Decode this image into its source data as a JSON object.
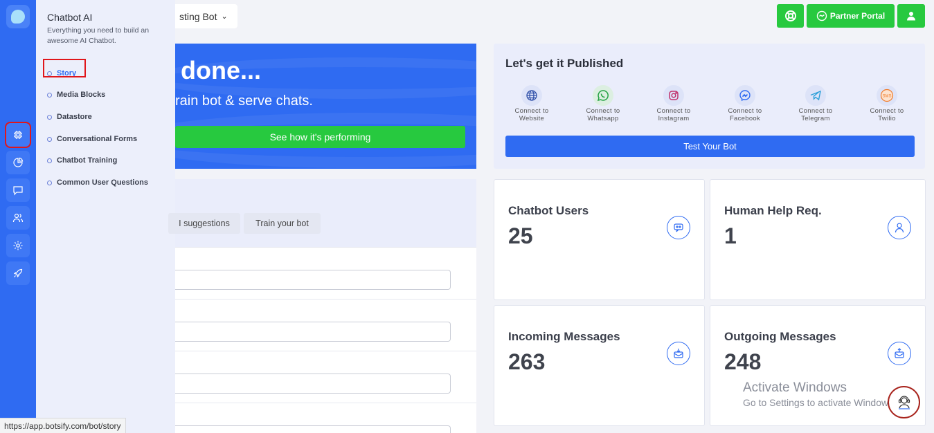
{
  "sidebar": {
    "icons": [
      "chatbot-icon",
      "pie-chart-icon",
      "message-icon",
      "users-icon",
      "gear-icon",
      "rocket-icon"
    ]
  },
  "flyout": {
    "title": "Chatbot AI",
    "description": "Everything you need to build an awesome AI Chatbot.",
    "items": [
      {
        "label": "Story"
      },
      {
        "label": "Media Blocks"
      },
      {
        "label": "Datastore"
      },
      {
        "label": "Conversational Forms"
      },
      {
        "label": "Chatbot Training"
      },
      {
        "label": "Common User Questions"
      }
    ]
  },
  "header": {
    "bot_name": "sting Bot",
    "partner_portal": "Partner Portal"
  },
  "hero": {
    "title": " done...",
    "subtitle": "rain bot & serve chats.",
    "cta": "See how it's performing"
  },
  "publish": {
    "title": "Let's get it Published",
    "channels": [
      {
        "line1": "Connect to",
        "line2": "Website",
        "icon": "globe-icon"
      },
      {
        "line1": "Connect to",
        "line2": "Whatsapp",
        "icon": "whatsapp-icon"
      },
      {
        "line1": "Connect to",
        "line2": "Instagram",
        "icon": "instagram-icon"
      },
      {
        "line1": "Connect to",
        "line2": "Facebook",
        "icon": "messenger-icon"
      },
      {
        "line1": "Connect to",
        "line2": "Telegram",
        "icon": "telegram-icon"
      },
      {
        "line1": "Connect to",
        "line2": "Twilio",
        "icon": "sms-icon"
      }
    ],
    "test_button": "Test Your Bot"
  },
  "training": {
    "tab_suggestions": "I suggestions",
    "tab_train": "Train your bot"
  },
  "stats": [
    {
      "label": "Chatbot Users",
      "value": "25"
    },
    {
      "label": "Human Help Req.",
      "value": "1"
    },
    {
      "label": "Incoming Messages",
      "value": "263"
    },
    {
      "label": "Outgoing Messages",
      "value": "248"
    }
  ],
  "watermark": {
    "line1": "Activate Windows",
    "line2": "Go to Settings to activate Windows."
  },
  "status_url": "https://app.botsify.com/bot/story",
  "colors": {
    "primary": "#2f6bf2",
    "green": "#27c93f",
    "highlight": "#e0161b"
  }
}
